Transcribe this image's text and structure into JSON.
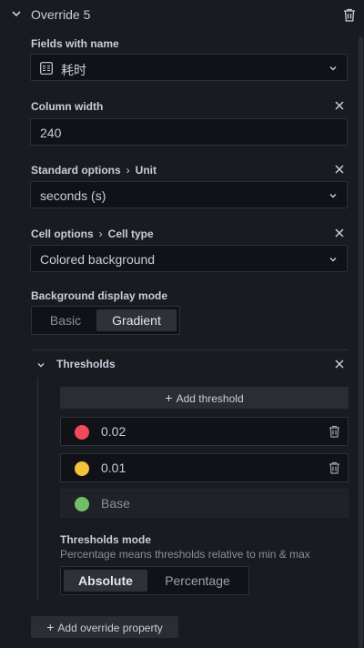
{
  "header": {
    "title": "Override 5"
  },
  "fields_with_name": {
    "label": "Fields with name",
    "value": "耗时"
  },
  "column_width": {
    "label": "Column width",
    "value": "240"
  },
  "standard_options": {
    "crumb1": "Standard options",
    "crumb2": "Unit",
    "value": "seconds (s)"
  },
  "cell_options": {
    "crumb1": "Cell options",
    "crumb2": "Cell type",
    "value": "Colored background"
  },
  "bg_display_mode": {
    "label": "Background display mode",
    "options": [
      "Basic",
      "Gradient"
    ],
    "selected": "Gradient"
  },
  "thresholds": {
    "label": "Thresholds",
    "add_label": "Add threshold",
    "items": [
      {
        "value": "0.02",
        "color": "#f2495c"
      },
      {
        "value": "0.01",
        "color": "#f2c23a"
      },
      {
        "value": "Base",
        "color": "#73bf69"
      }
    ]
  },
  "thresholds_mode": {
    "label": "Thresholds mode",
    "description": "Percentage means thresholds relative to min & max",
    "options": [
      "Absolute",
      "Percentage"
    ],
    "selected": "Absolute"
  },
  "add_override": {
    "label": "Add override property"
  }
}
